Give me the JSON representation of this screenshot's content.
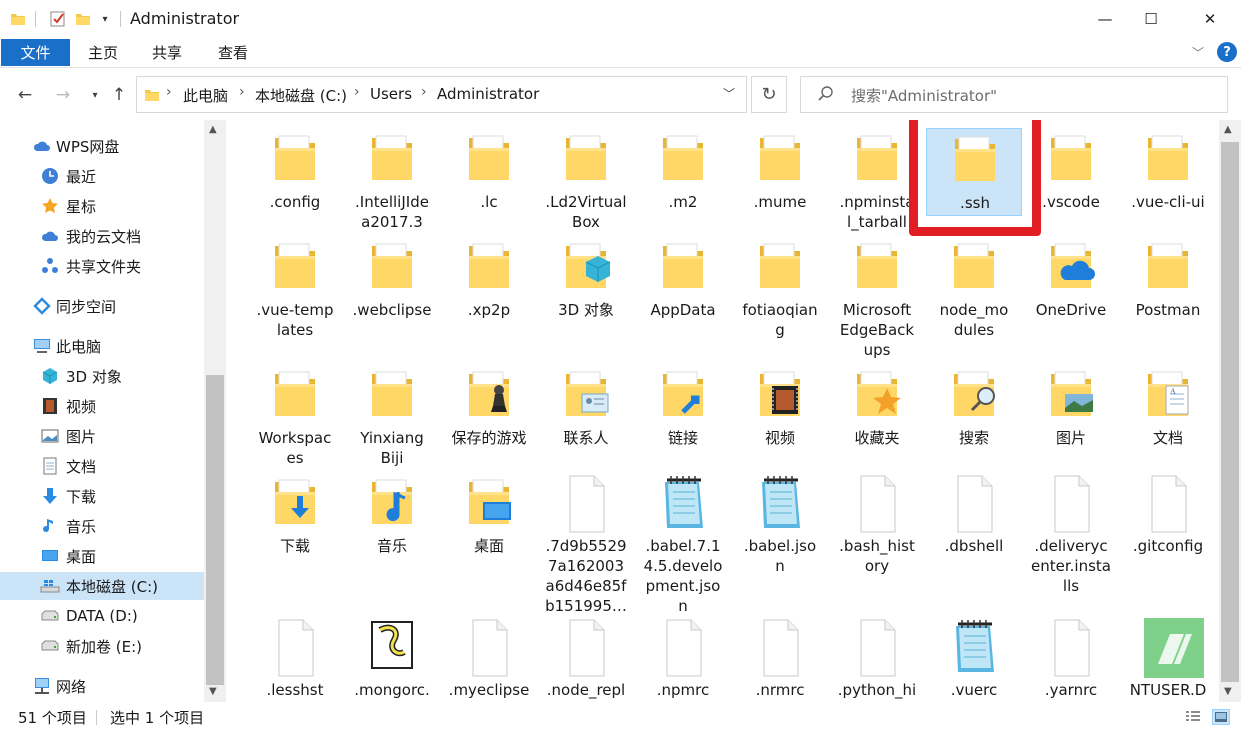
{
  "window": {
    "title": "Administrator",
    "controls": {
      "minimize": "—",
      "maximize": "☐",
      "close": "✕"
    }
  },
  "ribbon": {
    "file_tab": "文件",
    "tabs": [
      "主页",
      "共享",
      "查看"
    ],
    "help": "?"
  },
  "address": {
    "crumbs": [
      "此电脑",
      "本地磁盘 (C:)",
      "Users",
      "Administrator"
    ]
  },
  "search": {
    "placeholder": "搜索\"Administrator\""
  },
  "sidebar": {
    "items": [
      {
        "label": "WPS网盘",
        "icon": "cloud-icon"
      },
      {
        "label": "最近",
        "icon": "clock-icon"
      },
      {
        "label": "星标",
        "icon": "star-icon"
      },
      {
        "label": "我的云文档",
        "icon": "cloud-doc-icon"
      },
      {
        "label": "共享文件夹",
        "icon": "share-icon"
      },
      {
        "label": "同步空间",
        "icon": "sync-icon"
      },
      {
        "label": "此电脑",
        "icon": "computer-icon"
      },
      {
        "label": "3D 对象",
        "icon": "cube-icon"
      },
      {
        "label": "视频",
        "icon": "video-icon"
      },
      {
        "label": "图片",
        "icon": "picture-icon"
      },
      {
        "label": "文档",
        "icon": "document-icon"
      },
      {
        "label": "下载",
        "icon": "download-icon"
      },
      {
        "label": "音乐",
        "icon": "music-icon"
      },
      {
        "label": "桌面",
        "icon": "desktop-icon"
      },
      {
        "label": "本地磁盘 (C:)",
        "icon": "windows-drive-icon"
      },
      {
        "label": "DATA (D:)",
        "icon": "drive-icon"
      },
      {
        "label": "新加卷 (E:)",
        "icon": "drive-icon"
      },
      {
        "label": "网络",
        "icon": "network-icon"
      }
    ]
  },
  "files": [
    {
      "name": ".config",
      "icon": "folder-icon"
    },
    {
      "name": ".IntelliJIdea2017.3",
      "icon": "folder-icon"
    },
    {
      "name": ".lc",
      "icon": "folder-icon"
    },
    {
      "name": ".Ld2VirtualBox",
      "icon": "folder-icon"
    },
    {
      "name": ".m2",
      "icon": "folder-icon"
    },
    {
      "name": ".mume",
      "icon": "folder-icon"
    },
    {
      "name": ".npminstall_tarball",
      "icon": "folder-icon"
    },
    {
      "name": ".ssh",
      "icon": "folder-icon"
    },
    {
      "name": ".vscode",
      "icon": "folder-icon"
    },
    {
      "name": ".vue-cli-ui",
      "icon": "folder-icon"
    },
    {
      "name": ".vue-templates",
      "icon": "folder-icon"
    },
    {
      "name": ".webclipse",
      "icon": "folder-icon"
    },
    {
      "name": ".xp2p",
      "icon": "folder-icon"
    },
    {
      "name": "3D 对象",
      "icon": "3d-folder-icon"
    },
    {
      "name": "AppData",
      "icon": "folder-icon"
    },
    {
      "name": "fotiaoqiang",
      "icon": "folder-icon"
    },
    {
      "name": "MicrosoftEdgeBackups",
      "icon": "folder-icon"
    },
    {
      "name": "node_modules",
      "icon": "folder-icon"
    },
    {
      "name": "OneDrive",
      "icon": "onedrive-folder-icon"
    },
    {
      "name": "Postman",
      "icon": "folder-icon"
    },
    {
      "name": "Workspaces",
      "icon": "folder-icon"
    },
    {
      "name": "YinxiangBiji",
      "icon": "folder-icon"
    },
    {
      "name": "保存的游戏",
      "icon": "saved-games-icon"
    },
    {
      "name": "联系人",
      "icon": "contacts-icon"
    },
    {
      "name": "链接",
      "icon": "links-icon"
    },
    {
      "name": "视频",
      "icon": "videos-folder-icon"
    },
    {
      "name": "收藏夹",
      "icon": "favorites-icon"
    },
    {
      "name": "搜索",
      "icon": "searches-icon"
    },
    {
      "name": "图片",
      "icon": "pictures-folder-icon"
    },
    {
      "name": "文档",
      "icon": "documents-folder-icon"
    },
    {
      "name": "下载",
      "icon": "downloads-folder-icon"
    },
    {
      "name": "音乐",
      "icon": "music-folder-icon"
    },
    {
      "name": "桌面",
      "icon": "desktop-folder-icon"
    },
    {
      "name": ".7d9b55297a162003a6d46e85fb151995…",
      "icon": "file-icon"
    },
    {
      "name": ".babel.7.14.5.development.json",
      "icon": "notepad-icon"
    },
    {
      "name": ".babel.json",
      "icon": "notepad-icon"
    },
    {
      "name": ".bash_history",
      "icon": "file-icon"
    },
    {
      "name": ".dbshell",
      "icon": "file-icon"
    },
    {
      "name": ".deliverycenter.installs",
      "icon": "file-icon"
    },
    {
      "name": ".gitconfig",
      "icon": "file-icon"
    },
    {
      "name": ".lesshst",
      "icon": "file-icon"
    },
    {
      "name": ".mongorc.",
      "icon": "script-icon"
    },
    {
      "name": ".myeclipse",
      "icon": "file-icon"
    },
    {
      "name": ".node_repl",
      "icon": "file-icon"
    },
    {
      "name": ".npmrc",
      "icon": "file-icon"
    },
    {
      "name": ".nrmrc",
      "icon": "file-icon"
    },
    {
      "name": ".python_hi",
      "icon": "file-icon"
    },
    {
      "name": ".vuerc",
      "icon": "notepad-icon"
    },
    {
      "name": ".yarnrc",
      "icon": "file-icon"
    },
    {
      "name": "NTUSER.D",
      "icon": "ntuser-icon"
    }
  ],
  "selected_item": ".ssh",
  "status": {
    "count": "51 个项目",
    "selection": "选中 1 个项目"
  }
}
